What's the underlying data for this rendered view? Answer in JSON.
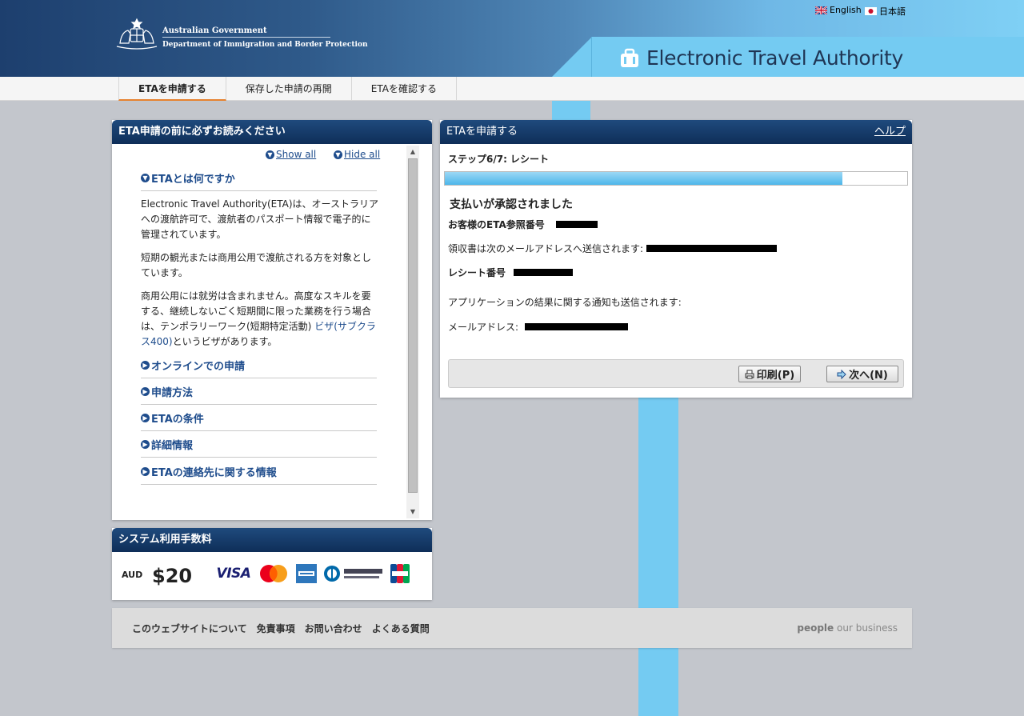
{
  "header": {
    "gov_line1": "Australian Government",
    "gov_line2": "Department of Immigration and Border Protection",
    "app_title": "Electronic Travel Authority",
    "lang_english": "English",
    "lang_japanese": "日本語"
  },
  "nav": {
    "tabs": [
      {
        "label": "ETAを申請する",
        "active": true
      },
      {
        "label": "保存した申請の再開",
        "active": false
      },
      {
        "label": "ETAを確認する",
        "active": false
      }
    ]
  },
  "info_panel": {
    "title": "ETA申請の前に必ずお読みください",
    "show_all": "Show all",
    "hide_all": "Hide all",
    "sections": [
      {
        "title": "ETAとは何ですか",
        "expanded": true
      },
      {
        "title": "オンラインでの申請",
        "expanded": false
      },
      {
        "title": "申請方法",
        "expanded": false
      },
      {
        "title": "ETAの条件",
        "expanded": false
      },
      {
        "title": "詳細情報",
        "expanded": false
      },
      {
        "title": "ETAの連絡先に関する情報",
        "expanded": false
      }
    ],
    "paragraph1": "Electronic Travel Authority(ETA)は、オーストラリアへの渡航許可で、渡航者のパスポート情報で電子的に管理されています。",
    "paragraph2": "短期の観光または商用公用で渡航される方を対象としています。",
    "paragraph3": "商用公用には就労は含まれません。高度なスキルを要する、継続しないごく短期間に限った業務を行う場合は、テンポラリーワーク(短期特定活動)",
    "paragraph3_link": "ビザ(サブクラス400)",
    "paragraph3_end": "というビザがあります。"
  },
  "fee_panel": {
    "title": "システム利用手数料",
    "currency": "AUD",
    "amount": "$20",
    "cards": [
      "VISA",
      "MasterCard",
      "American Express",
      "Diners Club",
      "JCB"
    ]
  },
  "apply_panel": {
    "title": "ETAを申請する",
    "help": "ヘルプ",
    "step": "ステップ6/7: レシート",
    "progress": 0.86,
    "confirm_title": "支払いが承認されました",
    "ref_label": "お客様のETA参照番号",
    "receipt_email_text": "領収書は次のメールアドレスへ送信されます:",
    "receipt_no_label": "レシート番号",
    "notify_text": "アプリケーションの結果に関する通知も送信されます:",
    "email_label": "メールアドレス:",
    "print_button": "印刷(P)",
    "next_button": "次へ(N)"
  },
  "footer": {
    "links": [
      "このウェブサイトについて",
      "免責事項",
      "お問い合わせ",
      "よくある質問"
    ],
    "tagline_bold": "people",
    "tagline_rest": " our business"
  },
  "colors": {
    "accent_blue": "#74cbf2",
    "panel_header": "#0e2e58",
    "link_blue": "#1e4c8c",
    "active_tab_underline": "#e6822f"
  }
}
